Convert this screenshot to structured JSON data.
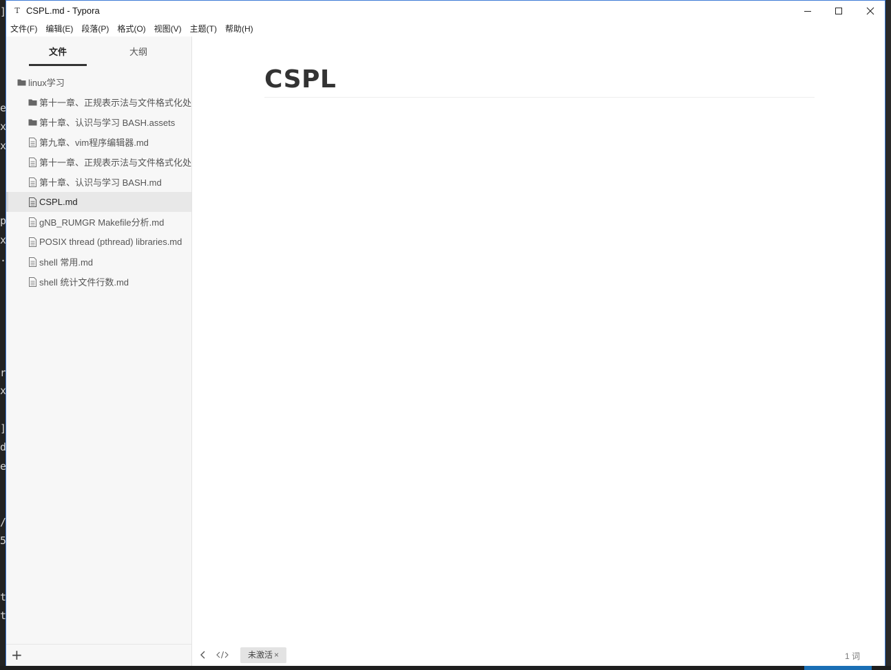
{
  "window": {
    "title": "CSPL.md - Typora",
    "app_icon_glyph": "T"
  },
  "menu": [
    {
      "label": "文件(F)"
    },
    {
      "label": "编辑(E)"
    },
    {
      "label": "段落(P)"
    },
    {
      "label": "格式(O)"
    },
    {
      "label": "视图(V)"
    },
    {
      "label": "主题(T)"
    },
    {
      "label": "帮助(H)"
    }
  ],
  "sidebar": {
    "tabs": [
      {
        "label": "文件",
        "active": true
      },
      {
        "label": "大纲",
        "active": false
      }
    ],
    "tree": [
      {
        "label": "linux学习",
        "type": "folder",
        "level": 0
      },
      {
        "label": "第十一章、正规表示法与文件格式化处理.assets",
        "type": "folder",
        "level": 1
      },
      {
        "label": "第十章、认识与学习 BASH.assets",
        "type": "folder",
        "level": 1
      },
      {
        "label": "第九章、vim程序编辑器.md",
        "type": "file",
        "level": 1
      },
      {
        "label": "第十一章、正规表示法与文件格式化处理.md",
        "type": "file",
        "level": 1
      },
      {
        "label": "第十章、认识与学习 BASH.md",
        "type": "file",
        "level": 1
      },
      {
        "label": "CSPL.md",
        "type": "file",
        "level": 1,
        "active": true
      },
      {
        "label": "gNB_RUMGR Makefile分析.md",
        "type": "file",
        "level": 1
      },
      {
        "label": "POSIX thread (pthread) libraries.md",
        "type": "file",
        "level": 1
      },
      {
        "label": "shell 常用.md",
        "type": "file",
        "level": 1
      },
      {
        "label": "shell 统计文件行数.md",
        "type": "file",
        "level": 1
      }
    ],
    "add_label": "+"
  },
  "document": {
    "heading": "CSPL"
  },
  "status": {
    "badge_label": "未激活",
    "badge_close": "×",
    "word_count": "1 词"
  },
  "background": {
    "terminal_chars": [
      "]",
      "e",
      "x",
      "x",
      "p",
      "x",
      "·",
      "r",
      "x",
      "]",
      "d",
      "e",
      "/",
      "5",
      "t",
      "t"
    ]
  },
  "colors": {
    "window_border": "#3d7bd6",
    "sidebar_bg": "#f7f7f7",
    "active_row": "#e8e8e8",
    "taskbar_accent": "#1a6fb5"
  }
}
